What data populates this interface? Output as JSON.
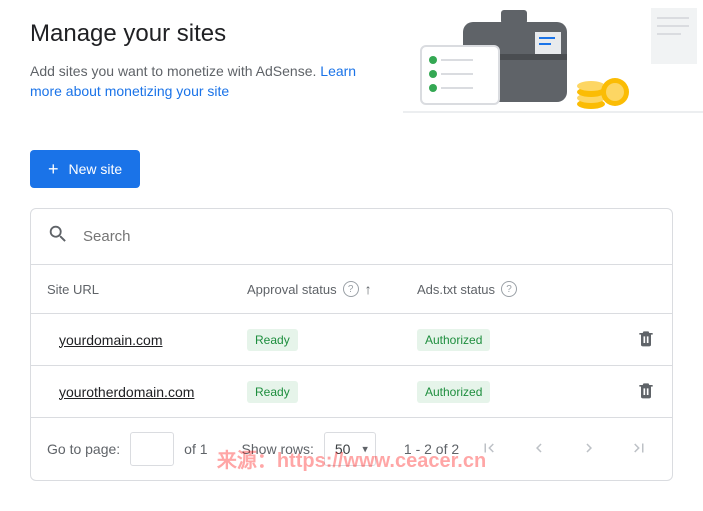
{
  "page": {
    "title": "Manage your sites",
    "subtitle_before": "Add sites you want to monetize with AdSense. ",
    "learn_more": "Learn more about monetizing your site"
  },
  "actions": {
    "new_site": "New site"
  },
  "search": {
    "placeholder": "Search"
  },
  "table": {
    "columns": {
      "url": "Site URL",
      "approval": "Approval status",
      "ads": "Ads.txt status"
    },
    "rows": [
      {
        "url": "yourdomain.com",
        "approval": "Ready",
        "ads": "Authorized"
      },
      {
        "url": "yourotherdomain.com",
        "approval": "Ready",
        "ads": "Authorized"
      }
    ]
  },
  "pagination": {
    "go_to_page": "Go to page:",
    "of_total": "of 1",
    "show_rows": "Show rows:",
    "rows_value": "50",
    "range": "1 - 2 of 2"
  },
  "watermark": "来源：https://www.ceacer.cn"
}
